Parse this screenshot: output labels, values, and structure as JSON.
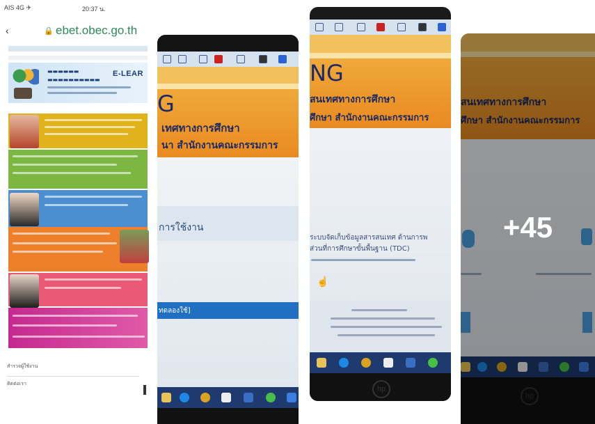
{
  "phone": {
    "carrier": "AIS 4G ✈",
    "time": "20:37 น.",
    "url": "ebet.obec.go.th",
    "banner_label": "E-LEAR",
    "menu_item_1": "สำรวจผู้ใช้งาน",
    "menu_item_2": "ติดต่อเรา"
  },
  "photo2": {
    "heading_partial": "G",
    "line1": "เทศทางการศึกษา",
    "line2": "นา สำนักงานคณะกรรมการ",
    "section": "การใช้งาน",
    "bar_text": "ทดลองใช้]"
  },
  "photo3": {
    "heading_partial": "NG",
    "line1": "สนเทศทางการศึกษา",
    "line2": "ศึกษา สำนักงานคณะกรรมการ",
    "body1": "ระบบจัดเก็บข้อมูลสารสนเทศ ด้านการพ",
    "body2": "ส่วนที่การศึกษาขั้นพื้นฐาน (TDC)"
  },
  "photo4": {
    "line1": "สนเทศทางการศึกษา",
    "line2": "ศึกษา สำนักงานคณะกรรมการ",
    "more_count": "+45"
  },
  "colors": {
    "url_green": "#2e8b57",
    "orange": "#e98a20",
    "taskbar": "#1e3a6e"
  }
}
